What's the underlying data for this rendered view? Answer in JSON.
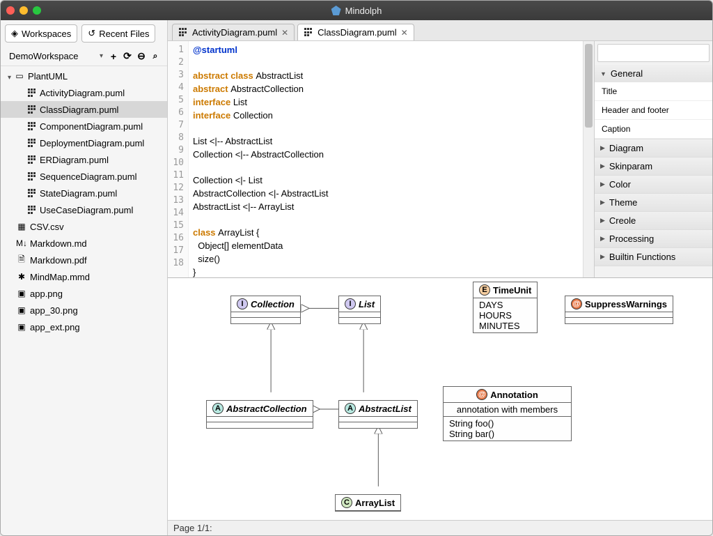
{
  "app": {
    "title": "Mindolph"
  },
  "sidebar": {
    "tabs": {
      "workspaces": "Workspaces",
      "recent": "Recent Files"
    },
    "workspace_name": "DemoWorkspace",
    "toolbar_icons": {
      "add": "+",
      "refresh": "⟳",
      "collapse": "⊖",
      "search": "🔍"
    },
    "tree": {
      "root": "PlantUML",
      "puml_files": [
        "ActivityDiagram.puml",
        "ClassDiagram.puml",
        "ComponentDiagram.puml",
        "DeploymentDiagram.puml",
        "ERDiagram.puml",
        "SequenceDiagram.puml",
        "StateDiagram.puml",
        "UseCaseDiagram.puml"
      ],
      "other_files": [
        {
          "name": "CSV.csv",
          "icon": "grid"
        },
        {
          "name": "Markdown.md",
          "icon": "md"
        },
        {
          "name": "Markdown.pdf",
          "icon": "doc"
        },
        {
          "name": "MindMap.mmd",
          "icon": "mmd"
        },
        {
          "name": "app.png",
          "icon": "img"
        },
        {
          "name": "app_30.png",
          "icon": "img"
        },
        {
          "name": "app_ext.png",
          "icon": "img"
        }
      ],
      "selected": "ClassDiagram.puml"
    }
  },
  "editor_tabs": [
    {
      "label": "ActivityDiagram.puml",
      "active": false
    },
    {
      "label": "ClassDiagram.puml",
      "active": true
    }
  ],
  "code_lines": [
    {
      "n": 1,
      "tokens": [
        [
          "@startuml",
          "kw"
        ]
      ]
    },
    {
      "n": 2,
      "tokens": []
    },
    {
      "n": 3,
      "tokens": [
        [
          "abstract ",
          "kw2"
        ],
        [
          "class ",
          "kw2"
        ],
        [
          "AbstractList",
          ""
        ]
      ]
    },
    {
      "n": 4,
      "tokens": [
        [
          "abstract ",
          "kw2"
        ],
        [
          "AbstractCollection",
          ""
        ]
      ]
    },
    {
      "n": 5,
      "tokens": [
        [
          "interface ",
          "kw2"
        ],
        [
          "List",
          ""
        ]
      ]
    },
    {
      "n": 6,
      "tokens": [
        [
          "interface ",
          "kw2"
        ],
        [
          "Collection",
          ""
        ]
      ]
    },
    {
      "n": 7,
      "tokens": []
    },
    {
      "n": 8,
      "tokens": [
        [
          "List <|-- AbstractList",
          ""
        ]
      ]
    },
    {
      "n": 9,
      "tokens": [
        [
          "Collection <|-- AbstractCollection",
          ""
        ]
      ]
    },
    {
      "n": 10,
      "tokens": []
    },
    {
      "n": 11,
      "tokens": [
        [
          "Collection <|- List",
          ""
        ]
      ]
    },
    {
      "n": 12,
      "tokens": [
        [
          "AbstractCollection <|- AbstractList",
          ""
        ]
      ]
    },
    {
      "n": 13,
      "tokens": [
        [
          "AbstractList <|-- ArrayList",
          ""
        ]
      ]
    },
    {
      "n": 14,
      "tokens": []
    },
    {
      "n": 15,
      "tokens": [
        [
          "class ",
          "kw2"
        ],
        [
          "ArrayList {",
          ""
        ]
      ]
    },
    {
      "n": 16,
      "tokens": [
        [
          "  Object[] elementData",
          ""
        ]
      ]
    },
    {
      "n": 17,
      "tokens": [
        [
          "  size()",
          ""
        ]
      ]
    },
    {
      "n": 18,
      "tokens": [
        [
          "}",
          ""
        ]
      ]
    }
  ],
  "props_panel": {
    "sections": [
      {
        "label": "General",
        "open": true,
        "items": [
          "Title",
          "Header and footer",
          "Caption"
        ]
      },
      {
        "label": "Diagram",
        "open": false
      },
      {
        "label": "Skinparam",
        "open": false
      },
      {
        "label": "Color",
        "open": false
      },
      {
        "label": "Theme",
        "open": false
      },
      {
        "label": "Creole",
        "open": false
      },
      {
        "label": "Processing",
        "open": false
      },
      {
        "label": "Builtin Functions",
        "open": false
      }
    ]
  },
  "status": {
    "page": "Page 1/1:"
  },
  "diagram": {
    "boxes": {
      "collection": {
        "badge": "I",
        "label": "Collection"
      },
      "list": {
        "badge": "I",
        "label": "List"
      },
      "abstractcollection": {
        "badge": "A",
        "label": "AbstractCollection"
      },
      "abstractlist": {
        "badge": "A",
        "label": "AbstractList"
      },
      "timeunit": {
        "badge": "E",
        "label": "TimeUnit",
        "members": [
          "DAYS",
          "HOURS",
          "MINUTES"
        ]
      },
      "suppress": {
        "badge": "@",
        "label": "SuppressWarnings"
      },
      "annotation": {
        "badge": "@",
        "label": "Annotation",
        "sub": "annotation with members",
        "members": [
          "String foo()",
          "String bar()"
        ]
      },
      "arraylist": {
        "badge": "C",
        "label": "ArrayList"
      }
    }
  }
}
